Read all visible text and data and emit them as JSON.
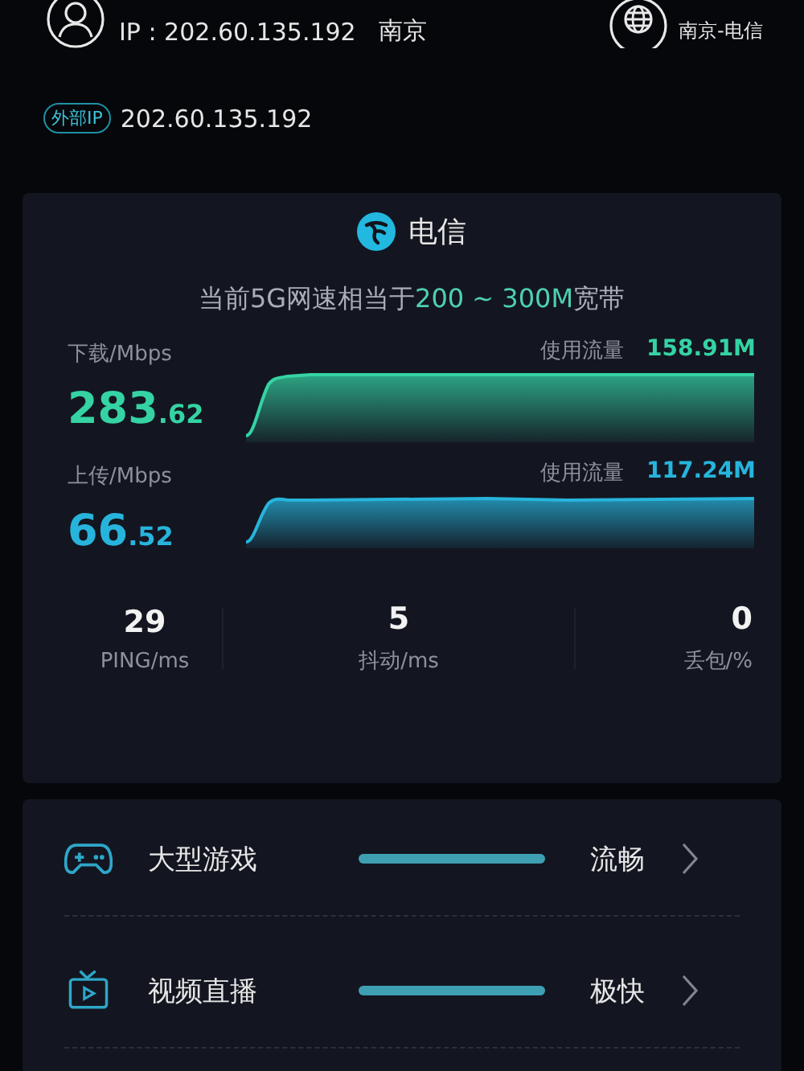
{
  "header": {
    "ip": "IP : 202.60.135.192",
    "city": "南京",
    "network": "南京-电信"
  },
  "external_ip": {
    "badge": "外部IP",
    "value": "202.60.135.192"
  },
  "speed_card": {
    "carrier": "电信",
    "summary": {
      "prefix": "当前5G网速相当于",
      "highlight": "200 ~ 300M",
      "suffix": "宽带"
    },
    "channels": [
      {
        "kind": "download",
        "label": "下载/Mbps",
        "integer": "283",
        "decimal": ".62",
        "usage_label": "使用流量",
        "usage": "158.91M"
      },
      {
        "kind": "upload",
        "label": "上传/Mbps",
        "integer": "66",
        "decimal": ".52",
        "usage_label": "使用流量",
        "usage": "117.24M"
      }
    ],
    "stats": [
      {
        "value": "29",
        "label": "PING/ms"
      },
      {
        "value": "5",
        "label": "抖动/ms"
      },
      {
        "value": "0",
        "label": "丢包/%"
      }
    ]
  },
  "scenarios": [
    {
      "kind": "game",
      "label": "大型游戏",
      "level": 1,
      "rating": "流畅"
    },
    {
      "kind": "video",
      "label": "视频直播",
      "level": 1,
      "rating": "极快"
    }
  ]
}
